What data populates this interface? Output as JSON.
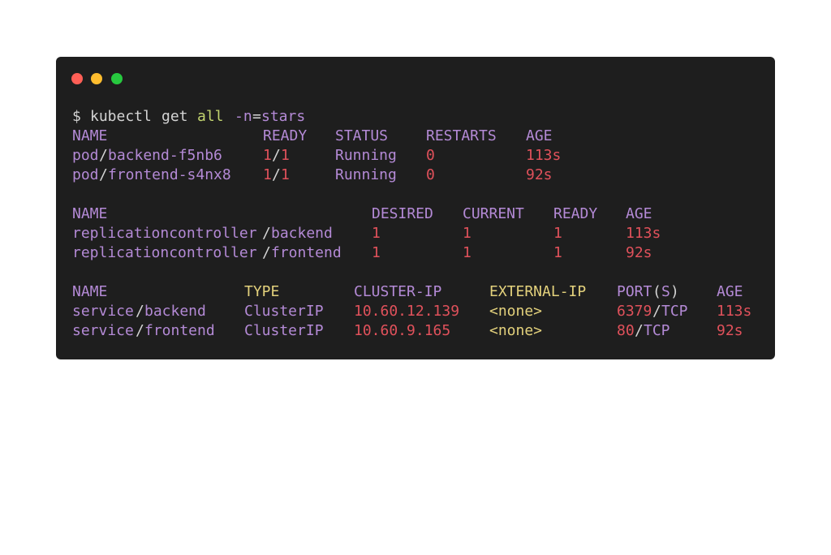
{
  "window": {
    "controls": [
      "close",
      "minimize",
      "maximize"
    ],
    "colors": {
      "close": "#ff5f56",
      "minimize": "#ffbd2e",
      "maximize": "#27c93f",
      "background": "#1e1e1e"
    }
  },
  "command": {
    "prompt": "$",
    "cmd": "kubectl",
    "verb": "get",
    "resource": "all",
    "flag": "-n",
    "equals": "=",
    "namespace": "stars"
  },
  "pods": {
    "headers": {
      "name": "NAME",
      "ready": "READY",
      "status": "STATUS",
      "restarts": "RESTARTS",
      "age": "AGE"
    },
    "rows": [
      {
        "kind": "pod",
        "name": "backend-f5nb6",
        "ready_a": "1",
        "ready_b": "1",
        "status": "Running",
        "restarts": "0",
        "age": "113s"
      },
      {
        "kind": "pod",
        "name": "frontend-s4nx8",
        "ready_a": "1",
        "ready_b": "1",
        "status": "Running",
        "restarts": "0",
        "age": "92s"
      }
    ]
  },
  "replicationcontrollers": {
    "headers": {
      "name": "NAME",
      "desired": "DESIRED",
      "current": "CURRENT",
      "ready": "READY",
      "age": "AGE"
    },
    "rows": [
      {
        "kind": "replicationcontroller",
        "name": "backend",
        "desired": "1",
        "current": "1",
        "ready": "1",
        "age": "113s"
      },
      {
        "kind": "replicationcontroller",
        "name": "frontend",
        "desired": "1",
        "current": "1",
        "ready": "1",
        "age": "92s"
      }
    ]
  },
  "services": {
    "headers": {
      "name": "NAME",
      "type": "TYPE",
      "cluster_ip": "CLUSTER-IP",
      "external_ip": "EXTERNAL-IP",
      "port": "PORT",
      "port_paren_open": "(",
      "port_s": "S",
      "port_paren_close": ")",
      "age": "AGE"
    },
    "rows": [
      {
        "kind": "service",
        "name": "backend",
        "type": "ClusterIP",
        "cluster_ip": "10.60.12.139",
        "external_ip": "<none>",
        "port": "6379",
        "proto": "TCP",
        "age": "113s"
      },
      {
        "kind": "service",
        "name": "frontend",
        "type": "ClusterIP",
        "cluster_ip": "10.60.9.165",
        "external_ip": "<none>",
        "port": "80",
        "proto": "TCP",
        "age": "92s"
      }
    ]
  },
  "separator": "/"
}
